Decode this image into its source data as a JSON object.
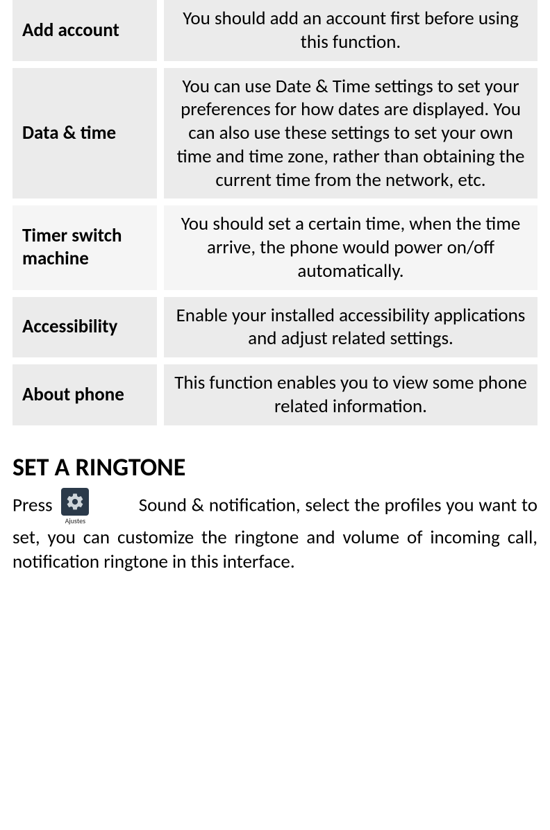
{
  "table": {
    "rows": [
      {
        "label": "Add account",
        "desc": "You should add an account first before using this function.",
        "alt": false
      },
      {
        "label": "Data & time",
        "desc": "You can use Date & Time settings to set your preferences for how dates are displayed. You can also use these settings to set your own time and time zone, rather than obtaining the current time from the network, etc.",
        "alt": false
      },
      {
        "label": "Timer switch machine",
        "desc": "You should set a certain time, when the time arrive, the phone would power on/off automatically.",
        "alt": true
      },
      {
        "label": "Accessibility",
        "desc": "Enable your installed accessibility applications and adjust related settings.",
        "alt": false
      },
      {
        "label": "About phone",
        "desc": "This function enables you to view some phone related information.",
        "alt": false
      }
    ]
  },
  "section": {
    "heading": "SET A RINGTONE",
    "press": "Press",
    "icon_caption": "Ajustes",
    "rest": "Sound & notification, select the profiles you want to set, you can customize the ringtone and volume of incoming call, notification ringtone in this interface."
  }
}
